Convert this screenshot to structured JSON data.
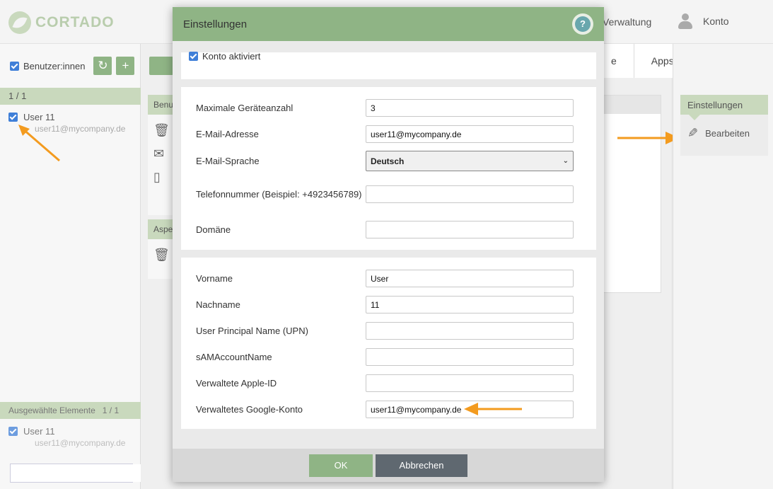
{
  "app": {
    "logo_text": "CORTADO"
  },
  "topbar": {
    "verwaltung": "Verwaltung",
    "konto": "Konto"
  },
  "left_panel": {
    "header_label": "Benutzer:innen",
    "count": "1 / 1",
    "users": [
      {
        "name": "User 11",
        "email": "user11@mycompany.de"
      }
    ],
    "selected_header": "Ausgewählte Elemente",
    "selected_count": "1 / 1",
    "selected_users": [
      {
        "name": "User 11",
        "email": "user11@mycompany.de"
      }
    ],
    "search_placeholder": ""
  },
  "mid_panel": {
    "tabs": [
      "e",
      "Apps"
    ],
    "card1_title": "Benu",
    "card2_title": "Aspe"
  },
  "right_panel": {
    "card_title": "Einstellungen",
    "edit_label": "Bearbeiten"
  },
  "modal": {
    "title": "Einstellungen",
    "help": "?",
    "konto_aktiviert": "Konto aktiviert",
    "section2": [
      {
        "label": "Maximale Geräteanzahl",
        "value": "3"
      },
      {
        "label": "E-Mail-Adresse",
        "value": "user11@mycompany.de"
      },
      {
        "label": "E-Mail-Sprache",
        "value": "Deutsch"
      },
      {
        "label": "Telefonnummer (Beispiel: +4923456789)",
        "value": ""
      },
      {
        "label": "Domäne",
        "value": ""
      }
    ],
    "section3": [
      {
        "label": "Vorname",
        "value": "User"
      },
      {
        "label": "Nachname",
        "value": "11"
      },
      {
        "label": "User Principal Name (UPN)",
        "value": ""
      },
      {
        "label": "sAMAccountName",
        "value": ""
      },
      {
        "label": "Verwaltete Apple-ID",
        "value": ""
      },
      {
        "label": "Verwaltetes Google-Konto",
        "value": "user11@mycompany.de"
      }
    ],
    "ok_label": "OK",
    "cancel_label": "Abbrechen"
  },
  "colors": {
    "accent_green": "#8fb485",
    "light_green": "#c9d9bd",
    "arrow_orange": "#f39b1f",
    "cancel_grey": "#5f6870"
  }
}
